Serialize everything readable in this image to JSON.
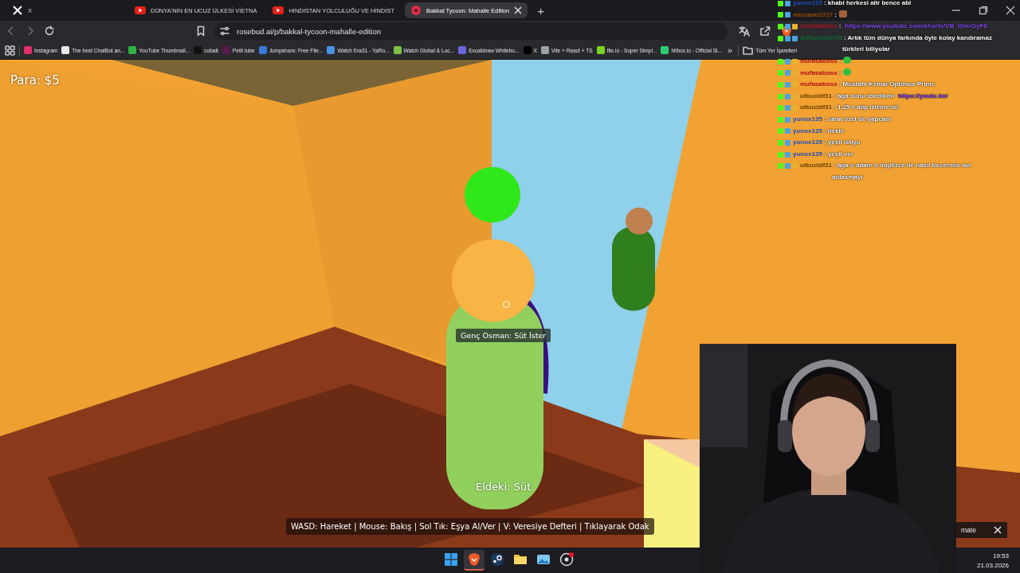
{
  "tabs": [
    {
      "label": "X",
      "kind": "x",
      "selected": false,
      "closable": false
    },
    {
      "label": "DÜNYA'NIN EN UCUZ ÜLKESİ VİETNA",
      "kind": "youtube",
      "selected": false,
      "closable": false
    },
    {
      "label": "HİNDİSTAN YOLCULUĞU VE HİNDİST",
      "kind": "youtube",
      "selected": false,
      "closable": false
    },
    {
      "label": "Bakkal Tycoon: Mahalle Edition",
      "kind": "rosebud",
      "selected": true,
      "closable": true
    }
  ],
  "new_tab": "+",
  "address": {
    "url": "rosebud.ai/p/bakkal-tycoon-mahalle-edition"
  },
  "bookmarks": [
    {
      "label": "Instagram",
      "color": "#e1306c"
    },
    {
      "label": "The best ChatBot an...",
      "color": "#e8e8e8"
    },
    {
      "label": "YouTube Thumbnail...",
      "color": "#2fb344"
    },
    {
      "label": "cobalt",
      "color": "#111111"
    },
    {
      "label": "Petit tube",
      "color": "#5a1a4a"
    },
    {
      "label": "Jumpshare: Free File...",
      "color": "#3a7bd5"
    },
    {
      "label": "Watch Era31 - YaRo...",
      "color": "#4a90e2"
    },
    {
      "label": "Watch Global & Loc...",
      "color": "#7cc242"
    },
    {
      "label": "Excalidraw Whitebo...",
      "color": "#6965db"
    },
    {
      "label": "X",
      "color": "#000000"
    },
    {
      "label": "Vite + React + TS",
      "color": "#9aa0a6"
    },
    {
      "label": "file.io - Super Simpl...",
      "color": "#7ad320"
    },
    {
      "label": "hitbox.io - Official Si...",
      "color": "#2ecc71"
    }
  ],
  "bookmarks_more": "»",
  "bookmarks_folder": "Tüm Yer İşaretleri",
  "game": {
    "money": "Para: $5",
    "npc_label": "Genç Osman: Süt İster",
    "holding": "Eldeki: Süt",
    "help": "WASD: Hareket | Mouse: Bakış | Sol Tık: Eşya Al/Ver | V: Veresiye Defteri | Tıklayarak Odak"
  },
  "chat": [
    {
      "user": "yunox135",
      "color": "#1d4fb8",
      "badges": [
        {
          "kind": "kick"
        },
        {
          "kind": "blue"
        }
      ],
      "kind": "text",
      "text": ": khabi herkesi alir bence abi"
    },
    {
      "user": "miccano2727",
      "color": "#9a4a00",
      "badges": [
        {
          "kind": "kick"
        },
        {
          "kind": "blue"
        }
      ],
      "kind": "emote_photo",
      "text": ":"
    },
    {
      "user": "mufasaboss",
      "color": "#b0101a",
      "badges": [
        {
          "kind": "kick"
        },
        {
          "kind": "blue"
        },
        {
          "kind": "crown"
        }
      ],
      "kind": "link",
      "text": ":",
      "link": "https://www.youtube.com/shorts/VB_I0mrOyF8"
    },
    {
      "user": "AliForesterTR",
      "color": "#0a6a30",
      "badges": [
        {
          "kind": "kick"
        },
        {
          "kind": "blue"
        },
        {
          "kind": "blue"
        }
      ],
      "kind": "text",
      "text": ": Artık tüm dünya farkında öyle kolay kandıramaz türkleri biliyolar"
    },
    {
      "user": "mufasaboss",
      "color": "#b0101a",
      "badges": [
        {
          "kind": "kick"
        },
        {
          "kind": "blue"
        },
        {
          "kind": "crown"
        }
      ],
      "kind": "emote_green",
      "text": ":"
    },
    {
      "user": "mufasaboss",
      "color": "#b0101a",
      "badges": [
        {
          "kind": "kick"
        },
        {
          "kind": "blue"
        },
        {
          "kind": "crown"
        }
      ],
      "kind": "emote_green",
      "text": ":"
    },
    {
      "user": "mufasaboss",
      "color": "#b0101a",
      "badges": [
        {
          "kind": "kick"
        },
        {
          "kind": "blue"
        },
        {
          "kind": "crown"
        }
      ],
      "kind": "text",
      "text": ": Mustafa Kemal Optimus Prime"
    },
    {
      "user": "utkucldf31",
      "color": "#6a4400",
      "badges": [
        {
          "kind": "kick"
        },
        {
          "kind": "blue"
        },
        {
          "kind": "crown"
        }
      ],
      "kind": "link",
      "text": ": aga sunu izledikmi",
      "link": "https://youtu.be/"
    },
    {
      "user": "utkucldf31",
      "color": "#6a4400",
      "badges": [
        {
          "kind": "kick"
        },
        {
          "kind": "blue"
        },
        {
          "kind": "crown"
        }
      ],
      "kind": "text",
      "text": ": 1.25 e alip izleme isi"
    },
    {
      "user": "yunox135",
      "color": "#1d4fb8",
      "badges": [
        {
          "kind": "kick"
        },
        {
          "kind": "blue"
        }
      ],
      "kind": "text",
      "text": ": sana ozel de yapcam"
    },
    {
      "user": "yunox135",
      "color": "#1d4fb8",
      "badges": [
        {
          "kind": "kick"
        },
        {
          "kind": "blue"
        }
      ],
      "kind": "text",
      "text": ": bekle"
    },
    {
      "user": "yunox135",
      "color": "#1d4fb8",
      "badges": [
        {
          "kind": "kick"
        },
        {
          "kind": "blue"
        }
      ],
      "kind": "text",
      "text": ": yeşil istiyo"
    },
    {
      "user": "yunox135",
      "color": "#1d4fb8",
      "badges": [
        {
          "kind": "kick"
        },
        {
          "kind": "blue"
        }
      ],
      "kind": "text",
      "text": ": yeşil ver"
    },
    {
      "user": "utkucldf31",
      "color": "#6a4400",
      "badges": [
        {
          "kind": "kick"
        },
        {
          "kind": "blue"
        },
        {
          "kind": "crown"
        }
      ],
      "kind": "text",
      "text": ": aga o adam o ingilizce ile nasil becermis lan anlasmayi"
    }
  ],
  "notification": {
    "text": "mate"
  },
  "taskbar": {
    "apps": [
      {
        "kind": "windows",
        "selected": false
      },
      {
        "kind": "brave",
        "selected": true
      },
      {
        "kind": "steam",
        "selected": false
      },
      {
        "kind": "folder",
        "selected": false
      },
      {
        "kind": "photos",
        "selected": false
      },
      {
        "kind": "obs",
        "selected": false
      }
    ],
    "time": "19:53",
    "date": "21.03.2026"
  }
}
